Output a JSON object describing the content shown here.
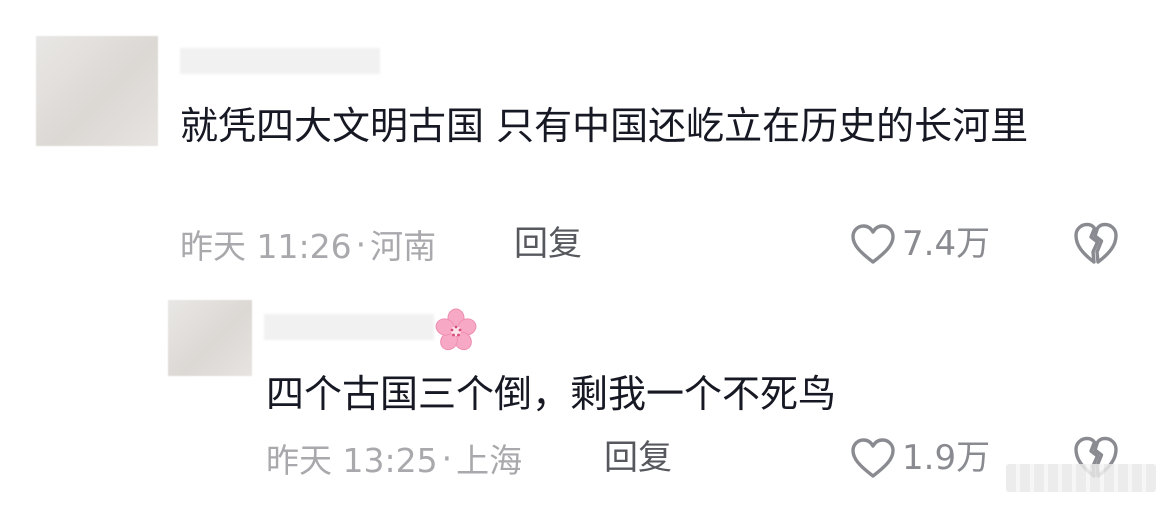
{
  "comments": [
    {
      "content": "就凭四大文明古国 只有中国还屹立在历史的长河里",
      "time": "昨天 11:26",
      "dot": "·",
      "location": "河南",
      "reply_label": "回复",
      "likes": "7.4万"
    },
    {
      "content": "四个古国三个倒，剩我一个不死鸟",
      "time": "昨天 13:25",
      "dot": "·",
      "location": "上海",
      "reply_label": "回复",
      "likes": "1.9万",
      "username_emoji": "cherry-blossom-icon"
    }
  ],
  "icons": {
    "like": "heart-outline-icon",
    "dislike": "broken-heart-icon"
  }
}
